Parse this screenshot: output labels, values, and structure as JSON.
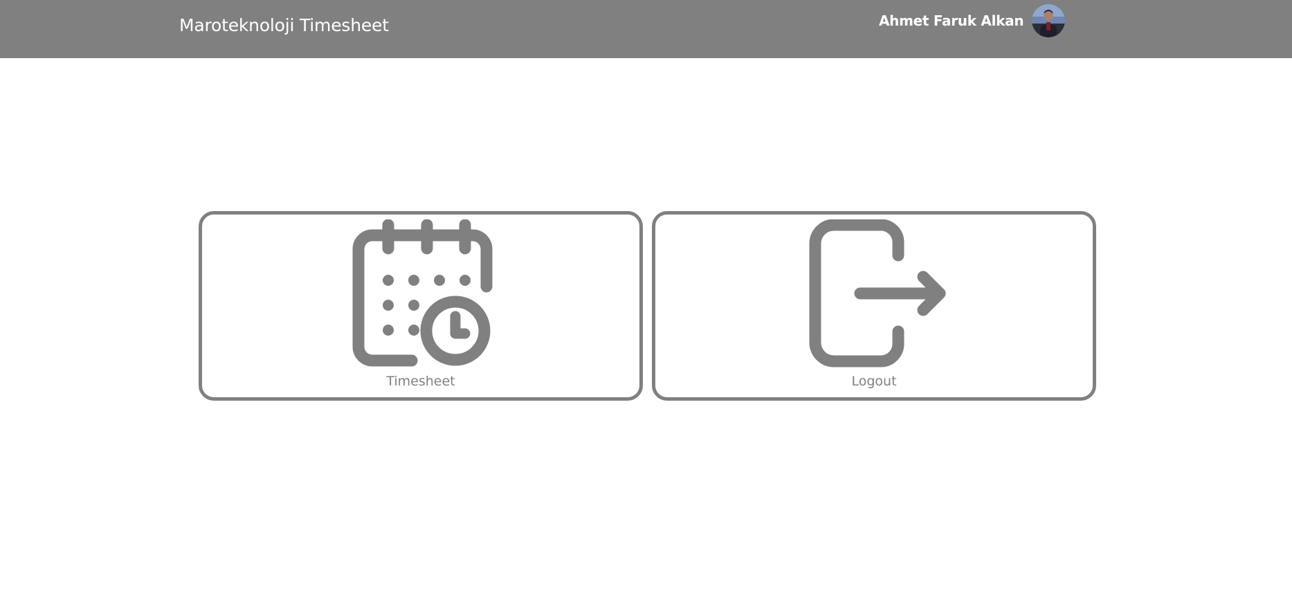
{
  "header": {
    "brand": "Maroteknoloji Timesheet",
    "user_name": "Ahmet Faruk Alkan",
    "avatar_icon": "user-avatar"
  },
  "menu": {
    "items": [
      {
        "label": "Timesheet",
        "icon": "calendar-clock-icon"
      },
      {
        "label": "Logout",
        "icon": "logout-icon"
      }
    ]
  },
  "colors": {
    "header_bg": "#808080",
    "accent": "#808080",
    "background": "#ffffff"
  }
}
